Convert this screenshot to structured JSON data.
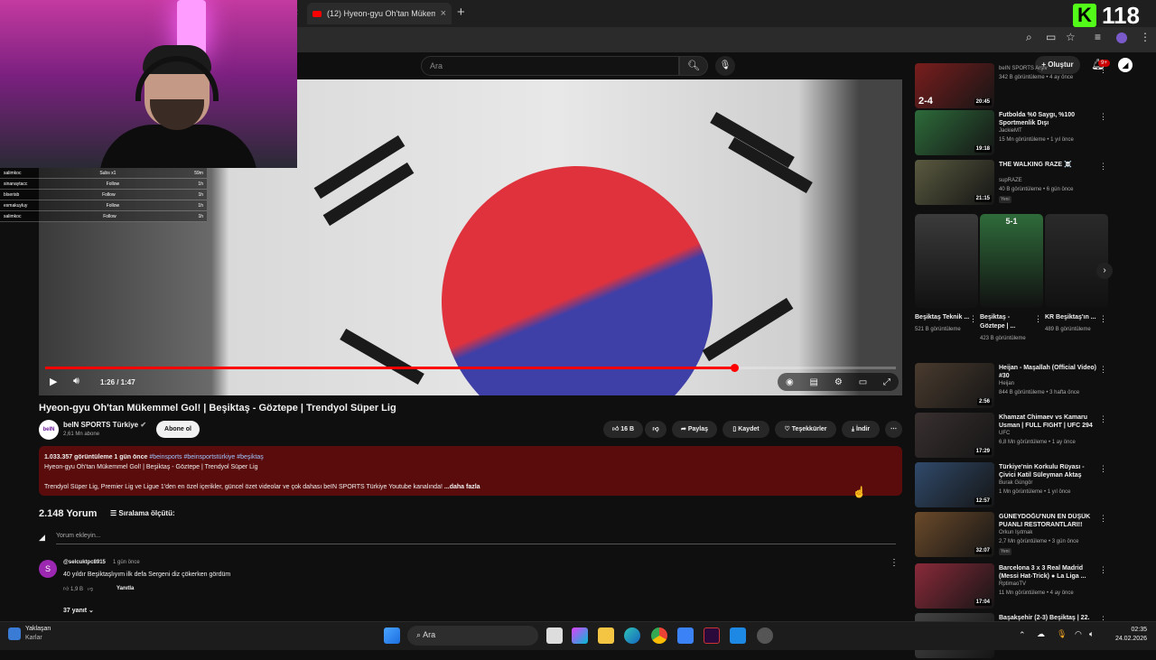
{
  "browser": {
    "tab_title": "(12) Hyeon-gyu Oh'tan Mükem",
    "new_tab": "+",
    "tab_close": "×"
  },
  "kick": {
    "logo": "K",
    "viewers": "118"
  },
  "masthead": {
    "search_placeholder": "Ara",
    "create_label": "Oluştur",
    "notifications_badge": "9+"
  },
  "webcam": {
    "chat": [
      {
        "user": "salimkoc",
        "event": "Subs x1",
        "time": "59m"
      },
      {
        "user": "sinanaytacc",
        "event": "Follow",
        "time": "1h"
      },
      {
        "user": "blserisb",
        "event": "Follow",
        "time": "1h"
      },
      {
        "user": "esmakuyluy",
        "event": "Follow",
        "time": "1h"
      },
      {
        "user": "salimkoc",
        "event": "Follow",
        "time": "1h"
      }
    ]
  },
  "player": {
    "time": "1:26 / 1:47",
    "progress": 0.81
  },
  "video": {
    "title": "Hyeon-gyu Oh'tan Mükemmel Gol! | Beşiktaş - Göztepe | Trendyol Süper Lig",
    "channel": "beIN SPORTS Türkiye",
    "channel_avatar": "beIN",
    "subscribers": "2,61 Mn abone",
    "subscribe": "Abone ol",
    "likes": "16 B",
    "share": "Paylaş",
    "save": "Kaydet",
    "thanks": "Teşekkürler",
    "download": "İndir"
  },
  "description": {
    "stats": "1.033.357 görüntüleme  1 gün önce",
    "tags": "#beinsports #beinsportstürkiye #beşiktaş",
    "line1": "Hyeon-gyu Oh'tan Mükemmel Gol! | Beşiktaş - Göztepe | Trendyol Süper Lig",
    "line2": "Trendyol Süper Lig, Premier Lig ve Ligue 1'den en özel içerikler, güncel özet videolar ve çok dahası beIN SPORTS Türkiye Youtube kanalında!",
    "more": "...daha fazla"
  },
  "comments": {
    "count": "2.148 Yorum",
    "sort": "Sıralama ölçütü:",
    "add_placeholder": "Yorum ekleyin...",
    "first": {
      "avatar": "S",
      "user": "@selcuktpc8915",
      "time": "1 gün önce",
      "text": "40 yıldır Beşiktaşlıyım ilk defa Sergeni diz çökerken gördüm",
      "likes": "1,9 B",
      "reply": "Yanıtla",
      "replies": "37 yanıt"
    }
  },
  "sidebar": {
    "top": [
      {
        "title": "",
        "channel": "beIN SPORTS Arşiv",
        "meta": "342 B görüntüleme • 4 ay önce",
        "duration": "20:45",
        "score": "2-4",
        "color": "#7a1d1d"
      }
    ],
    "upper": [
      {
        "title": "Futbolda %0 Saygı, %100 Sportmenlik Dışı",
        "channel": "JackieMT",
        "meta": "15 Mn görüntüleme • 1 yıl önce",
        "duration": "19:18",
        "color": "#2d6b3a"
      },
      {
        "title": "THE WALKING RAZE ☠️",
        "channel": "supRAZE",
        "meta": "40 B görüntüleme • 6 gün önce",
        "duration": "21:15",
        "badge": "Yeni",
        "color": "#5a5a40"
      }
    ],
    "shorts": [
      {
        "title": "Beşiktaş Teknik ...",
        "views": "521 B görüntüleme",
        "color": "#3b3b3b"
      },
      {
        "title": "Beşiktaş - Göztepe | ...",
        "views": "423 B görüntüleme",
        "color": "#2f6b3a",
        "overlay": "5-1"
      },
      {
        "title": "KR Beşiktaş'ın ...",
        "views": "489 B görüntüleme",
        "color": "#2a2a2a"
      }
    ],
    "lower": [
      {
        "title": "Heijan - Maşallah (Official Video) #30",
        "channel": "Heijan",
        "meta": "844 B görüntüleme • 3 hafta önce",
        "duration": "2:56",
        "color": "#4a3b2e"
      },
      {
        "title": "Khamzat Chimaev vs Kamaru Usman | FULL FIGHT | UFC 294",
        "channel": "UFC",
        "meta": "6,8 Mn görüntüleme • 1 ay önce",
        "duration": "17:29",
        "color": "#3a3030"
      },
      {
        "title": "Türkiye'nin Korkulu Rüyası - Çivici Katil Süleyman Aktaş",
        "channel": "Burak Güngör",
        "meta": "1 Mn görüntüleme • 1 yıl önce",
        "duration": "12:57",
        "color": "#304a6b"
      },
      {
        "title": "GÜNEYDOĞU'NUN EN DÜŞÜK PUANLI RESTORANTLARI!!",
        "channel": "Orkun Işıtmak",
        "meta": "2,7 Mn görüntüleme • 3 gün önce",
        "duration": "32:07",
        "badge": "Yeni",
        "color": "#6b4a2a"
      },
      {
        "title": "Barcelona 3 x 3 Real Madrid (Messi Hat-Trick) ● La Liga ...",
        "channel": "RptimaoTV",
        "meta": "11 Mn görüntüleme • 4 ay önce",
        "duration": "17:04",
        "color": "#8a2a3a"
      },
      {
        "title": "Başakşehir (2-3) Beşiktaş | 22.",
        "channel": "",
        "meta": "",
        "duration": "",
        "color": "#444"
      }
    ]
  },
  "taskbar": {
    "weather_title": "Yaklaşan",
    "weather_sub": "Karlar",
    "search": "Ara",
    "time": "02:35",
    "date": "24.02.2026"
  }
}
